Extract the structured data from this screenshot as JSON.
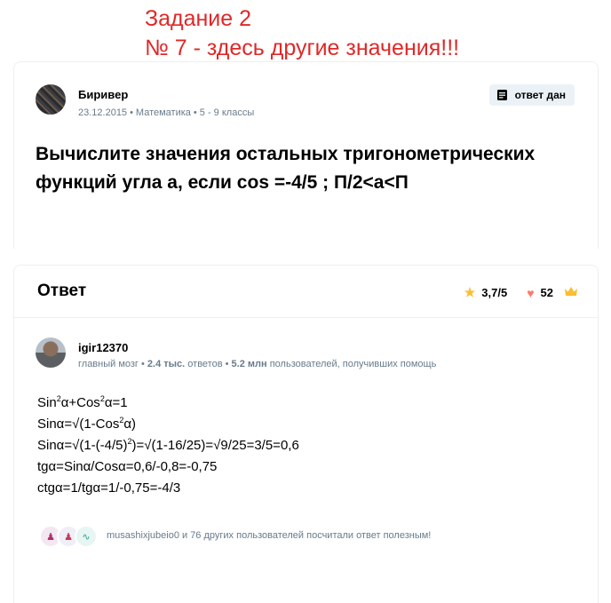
{
  "annotation": {
    "line1": "Задание 2",
    "line2": "№ 7 - здесь другие значения!!!"
  },
  "question": {
    "author": "Биривер",
    "date": "23.12.2015",
    "subject": "Математика",
    "grade": "5 - 9 классы",
    "badge": "ответ дан",
    "text": "Вычислите значения остальных тригонометрических функций угла a, если cos =-4/5 ; П/2<a<П"
  },
  "answer": {
    "heading": "Ответ",
    "rating": "3,7/5",
    "likes": "52",
    "author": "igir12370",
    "rank": "главный мозг",
    "answers_count": "2.4 тыс.",
    "answers_label": "ответов",
    "helped_count": "5.2 млн",
    "helped_label": "пользователей, получивших помощь",
    "lines": [
      {
        "a": "Sin",
        "b": "α+Cos",
        "c": "α=1"
      },
      {
        "a": "Sinα=√(1-Cos",
        "b": "α)",
        "c": ""
      },
      {
        "a": "Sinα=√(1-(-4/5)",
        "b": ")=√(1-16/25)=√9/25=3/5=0,6",
        "c": ""
      },
      {
        "a": "tgα=Sinα/Cosα=0,6/-0,8=-0,75"
      },
      {
        "a": "ctgα=1/tgα=1/-0,75=-4/3"
      }
    ],
    "thanks_text": "musashixjubeio0 и 76 других пользователей посчитали ответ полезным!"
  },
  "colors": {
    "annotation": "#e02828",
    "star": "#fbbe2e",
    "heart": "#ff7968",
    "muted": "#687b8c"
  }
}
